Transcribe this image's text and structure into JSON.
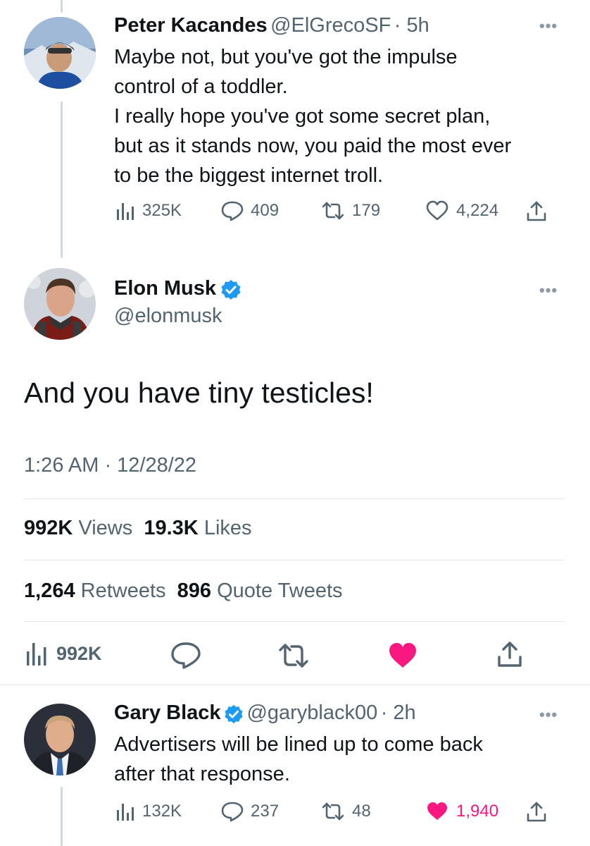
{
  "tweet1": {
    "name": "Peter Kacandes",
    "handle": "@ElGrecoSF",
    "time": "· 5h",
    "lines": [
      "Maybe not, but you've got the impulse",
      "control of a toddler.",
      "I really hope you've got some secret plan,",
      "but as it stands now, you paid the most ever",
      "to be the biggest internet troll."
    ],
    "views": "325K",
    "replies": "409",
    "retweets": "179",
    "likes": "4,224"
  },
  "main": {
    "name": "Elon Musk",
    "handle": "@elonmusk",
    "text": "And you have tiny testicles!",
    "timestamp": "1:26 AM · 12/28/22",
    "views_count": "992K",
    "views_label": "Views",
    "likes_count": "19.3K",
    "likes_label": "Likes",
    "retweets_count": "1,264",
    "retweets_label": "Retweets",
    "quotes_count": "896",
    "quotes_label": "Quote Tweets",
    "action_views": "992K"
  },
  "tweet3": {
    "name": "Gary Black",
    "handle": "@garyblack00",
    "time": "· 2h",
    "lines": [
      "Advertisers will be lined up to come back",
      "after that response."
    ],
    "views": "132K",
    "replies": "237",
    "retweets": "48",
    "likes": "1,940"
  },
  "colors": {
    "verified": "#1d9bf0",
    "liked": "#f91880",
    "secondary": "#536471"
  },
  "icons": [
    "views-icon",
    "reply-icon",
    "retweet-icon",
    "like-icon",
    "share-icon",
    "verified-badge-icon",
    "more-icon"
  ]
}
